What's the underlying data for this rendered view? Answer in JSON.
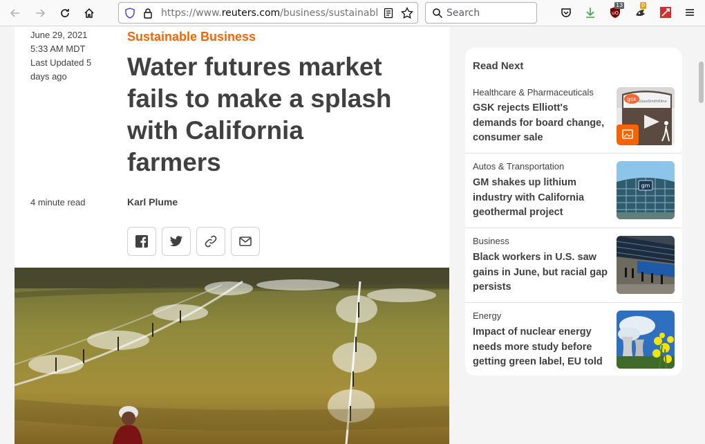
{
  "browser": {
    "url_prefix": "https://www.",
    "url_host": "reuters.com",
    "url_path": "/business/sustainable-b",
    "search_placeholder": "Search",
    "ublock_badge": "13",
    "ext2_badge": "0"
  },
  "article": {
    "date_lines": [
      "June 29, 2021",
      "5:33 AM MDT",
      "Last Updated 5",
      "days ago"
    ],
    "kicker": "Sustainable Business",
    "headline_lines": [
      "Water futures market",
      "fails to make a splash",
      "with California",
      "farmers"
    ],
    "read_time": "4 minute read",
    "author": "Karl Plume",
    "share": [
      "facebook-icon",
      "twitter-icon",
      "link-icon",
      "mail-icon"
    ]
  },
  "read_next": {
    "title": "Read Next",
    "items": [
      {
        "category": "Healthcare & Pharmaceuticals",
        "headline": "GSK rejects Elliott's demands for board change, consumer sale",
        "thumb": "gsk-sign-photo"
      },
      {
        "category": "Autos & Transportation",
        "headline": "GM shakes up lithium industry with California geothermal project",
        "thumb": "gm-building-photo"
      },
      {
        "category": "Business",
        "headline": "Black workers in U.S. saw gains in June, but racial gap persists",
        "thumb": "workers-photo"
      },
      {
        "category": "Energy",
        "headline": "Impact of nuclear energy needs more study before getting green label, EU told",
        "thumb": "nuclear-plant-photo"
      }
    ]
  },
  "colors": {
    "accent": "#fa6400",
    "text": "#404040"
  }
}
